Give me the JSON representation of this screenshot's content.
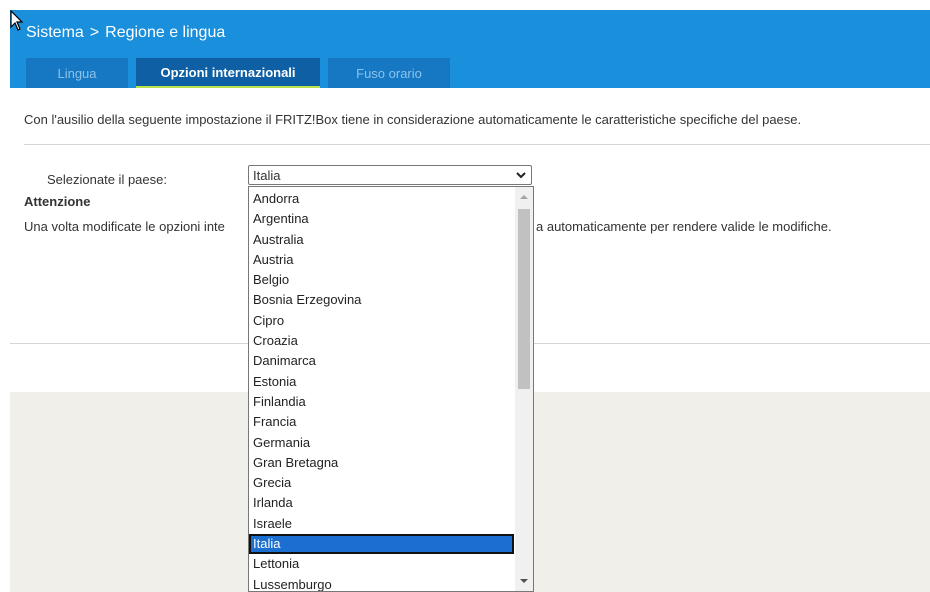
{
  "breadcrumb": {
    "section": "Sistema",
    "separator": ">",
    "page": "Regione e lingua"
  },
  "tabs": [
    {
      "label": "Lingua"
    },
    {
      "label": "Opzioni internazionali"
    },
    {
      "label": "Fuso orario"
    }
  ],
  "intro_text": "Con l'ausilio della seguente impostazione il FRITZ!Box tiene in considerazione automaticamente le caratteristiche specifiche del paese.",
  "country": {
    "label": "Selezionate il paese:",
    "selected": "Italia",
    "options": [
      "Andorra",
      "Argentina",
      "Australia",
      "Austria",
      "Belgio",
      "Bosnia Erzegovina",
      "Cipro",
      "Croazia",
      "Danimarca",
      "Estonia",
      "Finlandia",
      "Francia",
      "Germania",
      "Gran Bretagna",
      "Grecia",
      "Irlanda",
      "Israele",
      "Italia",
      "Lettonia",
      "Lussemburgo"
    ]
  },
  "warning": {
    "title": "Attenzione",
    "text_left": "Una volta modificate le opzioni inte",
    "text_right": "a automaticamente per rendere valide le modifiche."
  },
  "colors": {
    "header": "#1a8fdb",
    "tab_active": "#0e5fa3",
    "tab_underline": "#b8e24a",
    "selected_option": "#1a6fd0"
  },
  "icons": {
    "cursor": "mouse-pointer-icon",
    "dropdown": "chevron-down-icon"
  }
}
